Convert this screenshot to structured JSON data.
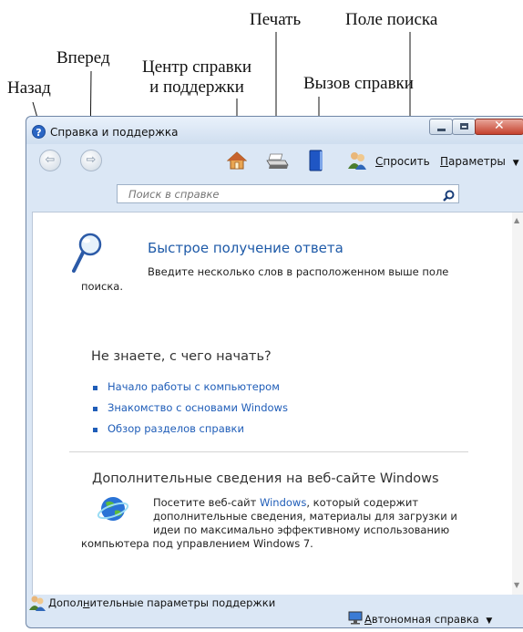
{
  "callouts": {
    "back": "Назад",
    "forward": "Вперед",
    "help_center_line1": "Центр справки",
    "help_center_line2": "и поддержки",
    "print": "Печать",
    "call_help": "Вызов справки",
    "search_field": "Поле поиска"
  },
  "window": {
    "title": "Справка и поддержка"
  },
  "toolbar": {
    "ask": {
      "pre": "",
      "ul": "С",
      "post": "просить"
    },
    "options": {
      "pre": "",
      "ul": "П",
      "post": "араметры"
    }
  },
  "search": {
    "placeholder": "Поиск в справке"
  },
  "content": {
    "quick": {
      "title": "Быстрое получение ответа",
      "desc_line1": "Введите несколько слов в расположенном выше поле",
      "desc_line2": "поиска."
    },
    "start": {
      "title": "Не знаете, с чего начать?",
      "links": [
        "Начало работы с компьютером",
        "Знакомство с основами Windows",
        "Обзор разделов справки"
      ]
    },
    "web": {
      "title": "Дополнительные сведения на веб-сайте Windows",
      "line1_pre": "Посетите веб-сайт ",
      "line1_link": "Windows",
      "line1_post": ", который содержит",
      "line2": "дополнительные сведения, материалы для загрузки и",
      "line3": "идеи по максимально эффективному использованию",
      "line4": "компьютера под управлением Windows 7."
    }
  },
  "status": {
    "support": {
      "pre": "Допол",
      "ul": "н",
      "post": "ительные параметры поддержки"
    },
    "offline": {
      "pre": "",
      "ul": "А",
      "post": "втономная справка"
    }
  },
  "colors": {
    "link": "#1f5db8",
    "heading": "#1e5aa8",
    "frame": "#dbe7f5"
  },
  "icons": [
    "back-arrow-icon",
    "forward-arrow-icon",
    "home-icon",
    "printer-icon",
    "help-book-icon",
    "people-icon",
    "magnifier-icon",
    "search-icon",
    "globe-icon",
    "support-people-icon",
    "monitor-icon",
    "chevron-down-icon",
    "minimize-icon",
    "maximize-icon",
    "close-icon"
  ]
}
